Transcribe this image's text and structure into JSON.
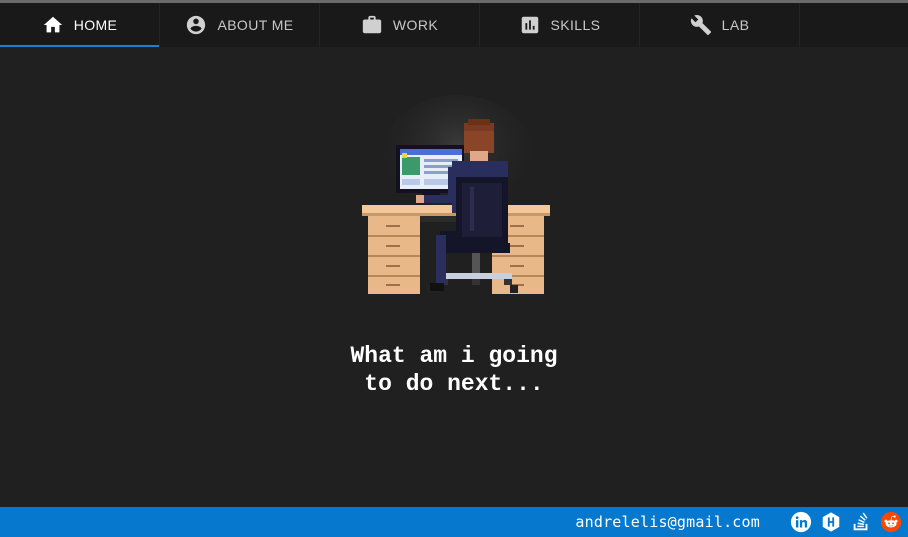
{
  "nav": {
    "tabs": [
      {
        "label": "HOME",
        "icon": "home-icon",
        "active": true
      },
      {
        "label": "ABOUT ME",
        "icon": "account-circle-icon",
        "active": false
      },
      {
        "label": "WORK",
        "icon": "briefcase-icon",
        "active": false
      },
      {
        "label": "SKILLS",
        "icon": "bar-chart-icon",
        "active": false
      },
      {
        "label": "LAB",
        "icon": "wrench-icon",
        "active": false
      }
    ]
  },
  "hero": {
    "illustration": "pixel-art-developer-at-desk",
    "headline_line1": "What am i going",
    "headline_line2": "to do next..."
  },
  "footer": {
    "email": "andrelelis@gmail.com",
    "social": [
      {
        "name": "linkedin-icon"
      },
      {
        "name": "hackerrank-icon"
      },
      {
        "name": "stackoverflow-icon"
      },
      {
        "name": "reddit-icon"
      }
    ]
  },
  "colors": {
    "background": "#202020",
    "nav_background": "#191919",
    "active_underline": "#1a7fd6",
    "footer_background": "#0679cf",
    "reddit": "#ff4500"
  }
}
